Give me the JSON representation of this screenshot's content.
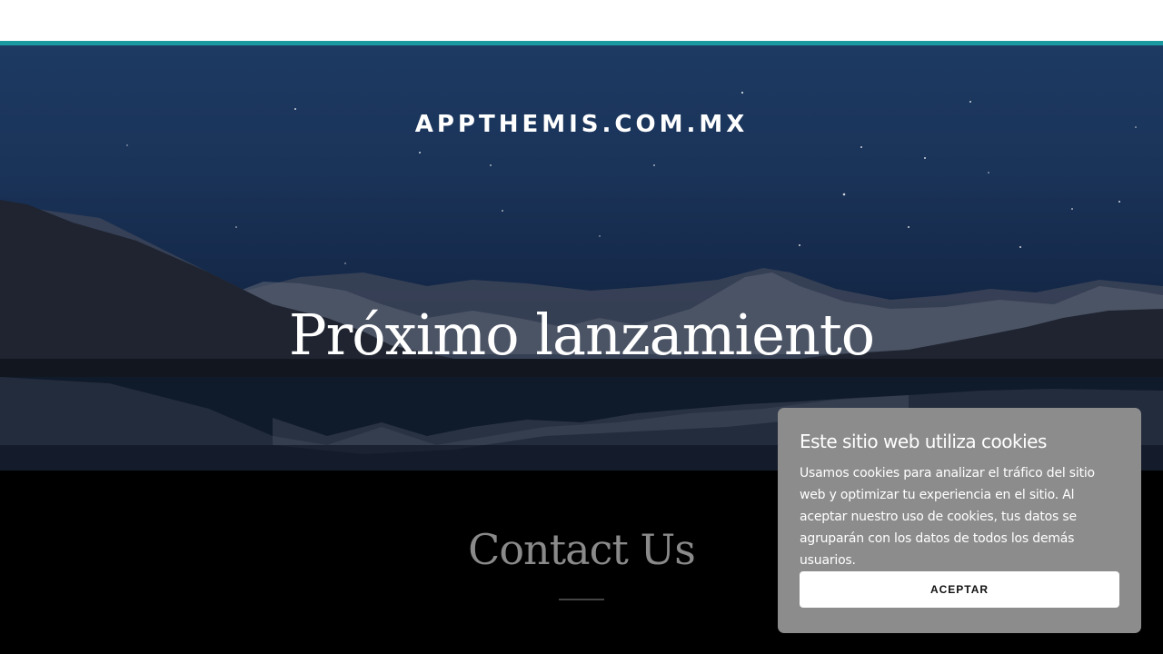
{
  "header": {
    "site_title": "APPTHEMIS.COM.MX"
  },
  "hero": {
    "headline": "Próximo lanzamiento"
  },
  "contact": {
    "title": "Contact Us"
  },
  "cookie_banner": {
    "title": "Este sitio web utiliza cookies",
    "body": "Usamos cookies para analizar el tráfico del sitio web y optimizar tu experiencia en el sitio. Al aceptar nuestro uso de cookies, tus datos se agruparán con los datos de todos los demás usuarios.",
    "accept_label": "ACEPTAR"
  },
  "colors": {
    "accent": "#1a9aa0",
    "cookie_panel": "#8c8c8c",
    "contact_title": "#8a8a8a"
  }
}
